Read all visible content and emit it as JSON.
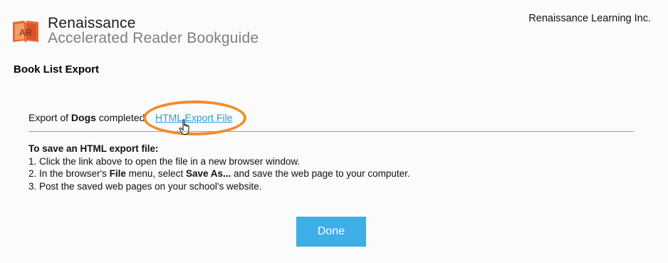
{
  "header": {
    "brand_name": "Renaissance",
    "product_name": "Accelerated Reader Bookguide",
    "logo_text": "AR",
    "company": "Renaissance Learning Inc."
  },
  "page": {
    "title": "Book List Export"
  },
  "export": {
    "prefix": "Export of ",
    "list_name": "Dogs",
    "suffix": " completed.",
    "link_label": "HTML Export File"
  },
  "instructions": {
    "heading": "To save an HTML export file:",
    "step1": "1. Click the link above to open the file in a new browser window.",
    "step2_a": "2. In the browser's ",
    "step2_b": "File",
    "step2_c": " menu, select ",
    "step2_d": "Save As...",
    "step2_e": " and save the web page to your computer.",
    "step3": "3. Post the saved web pages on your school's website."
  },
  "actions": {
    "done_label": "Done"
  },
  "colors": {
    "accent": "#3daee6",
    "link": "#2a9bd4",
    "highlight": "#f08c2c",
    "logo": "#e05a2a"
  },
  "icons": [
    "ar-book-logo-icon",
    "hand-pointer-cursor-icon"
  ]
}
